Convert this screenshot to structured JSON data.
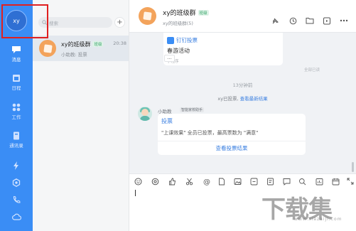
{
  "user": {
    "avatar_text": "xy"
  },
  "nav": {
    "items": [
      {
        "label": "消息",
        "icon": "chat-icon"
      },
      {
        "label": "日程",
        "icon": "calendar-icon"
      },
      {
        "label": "工作",
        "icon": "apps-icon"
      },
      {
        "label": "通讯录",
        "icon": "contacts-icon"
      }
    ],
    "bottom_icons": [
      "lightning-icon",
      "settings-icon",
      "phone-icon",
      "cloud-icon"
    ]
  },
  "search": {
    "placeholder": "搜索"
  },
  "conversation": {
    "name": "xy的班级群",
    "tag": "班级",
    "preview": "小助教: 投票",
    "time": "20:38"
  },
  "chat": {
    "title": "xy的班级群",
    "tag": "班级",
    "subtitle": "xy的班级群(5)",
    "card_top": {
      "badge": "钉钉投票",
      "activity": "春游活动",
      "source": "小程序",
      "more": "..."
    },
    "read_status": "全部已读",
    "time_separator": "13分钟前",
    "system_text": "xy已投票,",
    "system_link": "查看最新结果",
    "bot_name": "小助教",
    "bot_tag": "智能家校助手",
    "vote_card": {
      "title": "投票",
      "description": "\"上课效果\" 全员已投票，最高票数为 \"满意\"",
      "result_link": "查看投票结果"
    }
  },
  "watermark": {
    "text": "下载集",
    "url": "www.xiazaiji.com"
  }
}
